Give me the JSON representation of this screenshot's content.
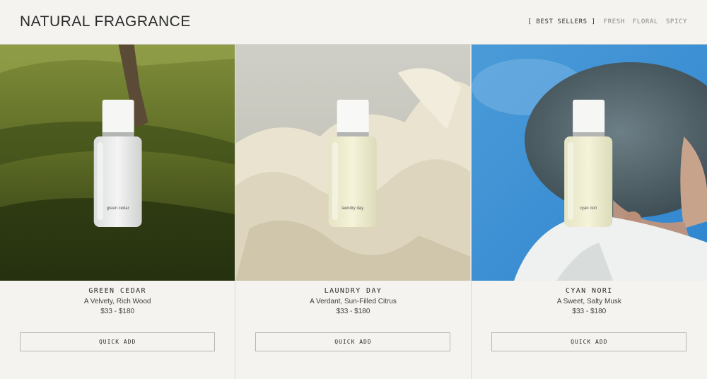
{
  "brand": "NATURAL FRAGRANCE",
  "nav": [
    {
      "label": "[ BEST SELLERS ]",
      "active": true
    },
    {
      "label": "FRESH",
      "active": false
    },
    {
      "label": "FLORAL",
      "active": false
    },
    {
      "label": "SPICY",
      "active": false
    }
  ],
  "products": [
    {
      "name": "GREEN CEDAR",
      "tagline": "A Velvety, Rich Wood",
      "price": "$33 - $180",
      "bottle_label": "green cedar",
      "button": "QUICK ADD"
    },
    {
      "name": "LAUNDRY DAY",
      "tagline": "A Verdant, Sun-Filled Citrus",
      "price": "$33 - $180",
      "bottle_label": "laundry day",
      "button": "QUICK ADD"
    },
    {
      "name": "CYAN NORI",
      "tagline": "A Sweet, Salty Musk",
      "price": "$33 - $180",
      "bottle_label": "cyan nori",
      "button": "QUICK ADD"
    }
  ]
}
